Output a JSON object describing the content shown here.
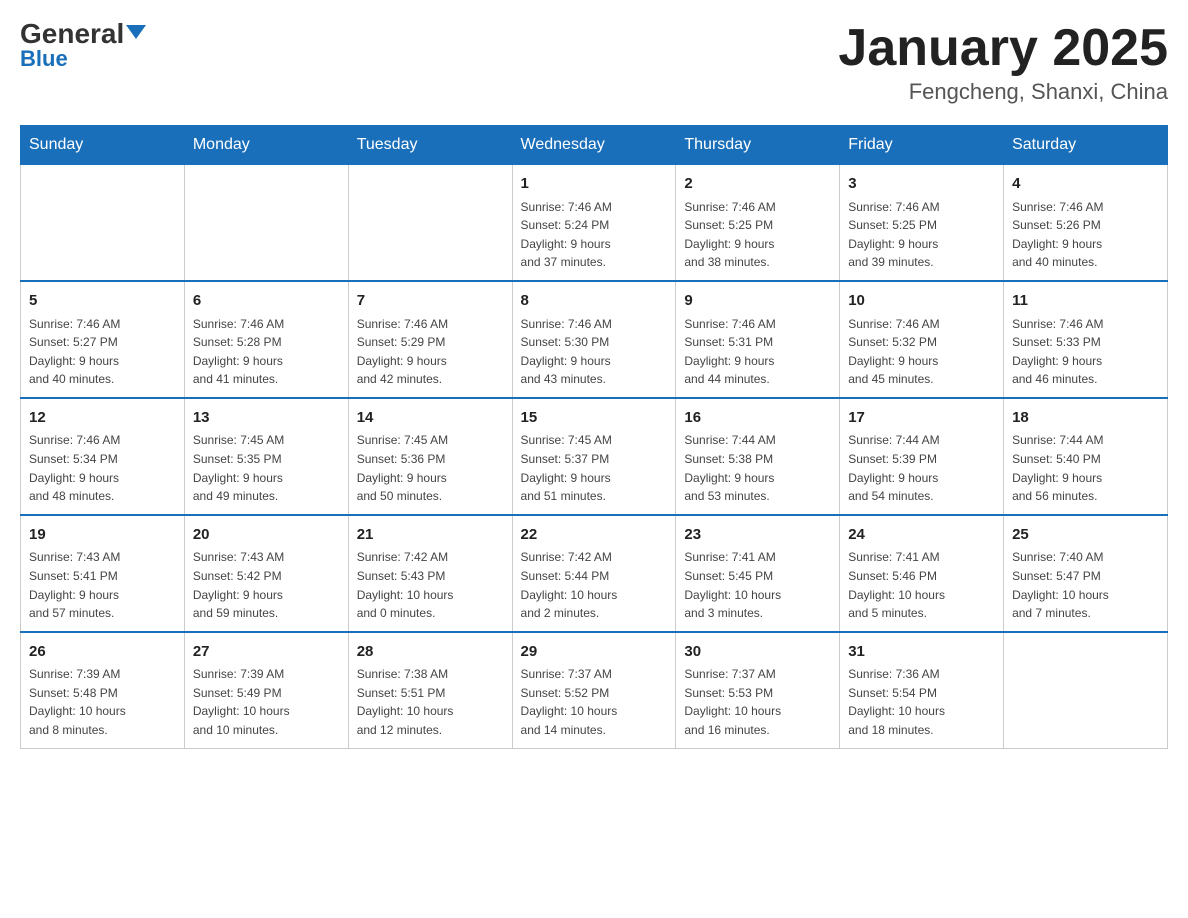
{
  "header": {
    "logo_main": "General",
    "logo_blue": "Blue",
    "month_title": "January 2025",
    "location": "Fengcheng, Shanxi, China"
  },
  "weekdays": [
    "Sunday",
    "Monday",
    "Tuesday",
    "Wednesday",
    "Thursday",
    "Friday",
    "Saturday"
  ],
  "weeks": [
    [
      {
        "day": "",
        "info": ""
      },
      {
        "day": "",
        "info": ""
      },
      {
        "day": "",
        "info": ""
      },
      {
        "day": "1",
        "info": "Sunrise: 7:46 AM\nSunset: 5:24 PM\nDaylight: 9 hours\nand 37 minutes."
      },
      {
        "day": "2",
        "info": "Sunrise: 7:46 AM\nSunset: 5:25 PM\nDaylight: 9 hours\nand 38 minutes."
      },
      {
        "day": "3",
        "info": "Sunrise: 7:46 AM\nSunset: 5:25 PM\nDaylight: 9 hours\nand 39 minutes."
      },
      {
        "day": "4",
        "info": "Sunrise: 7:46 AM\nSunset: 5:26 PM\nDaylight: 9 hours\nand 40 minutes."
      }
    ],
    [
      {
        "day": "5",
        "info": "Sunrise: 7:46 AM\nSunset: 5:27 PM\nDaylight: 9 hours\nand 40 minutes."
      },
      {
        "day": "6",
        "info": "Sunrise: 7:46 AM\nSunset: 5:28 PM\nDaylight: 9 hours\nand 41 minutes."
      },
      {
        "day": "7",
        "info": "Sunrise: 7:46 AM\nSunset: 5:29 PM\nDaylight: 9 hours\nand 42 minutes."
      },
      {
        "day": "8",
        "info": "Sunrise: 7:46 AM\nSunset: 5:30 PM\nDaylight: 9 hours\nand 43 minutes."
      },
      {
        "day": "9",
        "info": "Sunrise: 7:46 AM\nSunset: 5:31 PM\nDaylight: 9 hours\nand 44 minutes."
      },
      {
        "day": "10",
        "info": "Sunrise: 7:46 AM\nSunset: 5:32 PM\nDaylight: 9 hours\nand 45 minutes."
      },
      {
        "day": "11",
        "info": "Sunrise: 7:46 AM\nSunset: 5:33 PM\nDaylight: 9 hours\nand 46 minutes."
      }
    ],
    [
      {
        "day": "12",
        "info": "Sunrise: 7:46 AM\nSunset: 5:34 PM\nDaylight: 9 hours\nand 48 minutes."
      },
      {
        "day": "13",
        "info": "Sunrise: 7:45 AM\nSunset: 5:35 PM\nDaylight: 9 hours\nand 49 minutes."
      },
      {
        "day": "14",
        "info": "Sunrise: 7:45 AM\nSunset: 5:36 PM\nDaylight: 9 hours\nand 50 minutes."
      },
      {
        "day": "15",
        "info": "Sunrise: 7:45 AM\nSunset: 5:37 PM\nDaylight: 9 hours\nand 51 minutes."
      },
      {
        "day": "16",
        "info": "Sunrise: 7:44 AM\nSunset: 5:38 PM\nDaylight: 9 hours\nand 53 minutes."
      },
      {
        "day": "17",
        "info": "Sunrise: 7:44 AM\nSunset: 5:39 PM\nDaylight: 9 hours\nand 54 minutes."
      },
      {
        "day": "18",
        "info": "Sunrise: 7:44 AM\nSunset: 5:40 PM\nDaylight: 9 hours\nand 56 minutes."
      }
    ],
    [
      {
        "day": "19",
        "info": "Sunrise: 7:43 AM\nSunset: 5:41 PM\nDaylight: 9 hours\nand 57 minutes."
      },
      {
        "day": "20",
        "info": "Sunrise: 7:43 AM\nSunset: 5:42 PM\nDaylight: 9 hours\nand 59 minutes."
      },
      {
        "day": "21",
        "info": "Sunrise: 7:42 AM\nSunset: 5:43 PM\nDaylight: 10 hours\nand 0 minutes."
      },
      {
        "day": "22",
        "info": "Sunrise: 7:42 AM\nSunset: 5:44 PM\nDaylight: 10 hours\nand 2 minutes."
      },
      {
        "day": "23",
        "info": "Sunrise: 7:41 AM\nSunset: 5:45 PM\nDaylight: 10 hours\nand 3 minutes."
      },
      {
        "day": "24",
        "info": "Sunrise: 7:41 AM\nSunset: 5:46 PM\nDaylight: 10 hours\nand 5 minutes."
      },
      {
        "day": "25",
        "info": "Sunrise: 7:40 AM\nSunset: 5:47 PM\nDaylight: 10 hours\nand 7 minutes."
      }
    ],
    [
      {
        "day": "26",
        "info": "Sunrise: 7:39 AM\nSunset: 5:48 PM\nDaylight: 10 hours\nand 8 minutes."
      },
      {
        "day": "27",
        "info": "Sunrise: 7:39 AM\nSunset: 5:49 PM\nDaylight: 10 hours\nand 10 minutes."
      },
      {
        "day": "28",
        "info": "Sunrise: 7:38 AM\nSunset: 5:51 PM\nDaylight: 10 hours\nand 12 minutes."
      },
      {
        "day": "29",
        "info": "Sunrise: 7:37 AM\nSunset: 5:52 PM\nDaylight: 10 hours\nand 14 minutes."
      },
      {
        "day": "30",
        "info": "Sunrise: 7:37 AM\nSunset: 5:53 PM\nDaylight: 10 hours\nand 16 minutes."
      },
      {
        "day": "31",
        "info": "Sunrise: 7:36 AM\nSunset: 5:54 PM\nDaylight: 10 hours\nand 18 minutes."
      },
      {
        "day": "",
        "info": ""
      }
    ]
  ]
}
